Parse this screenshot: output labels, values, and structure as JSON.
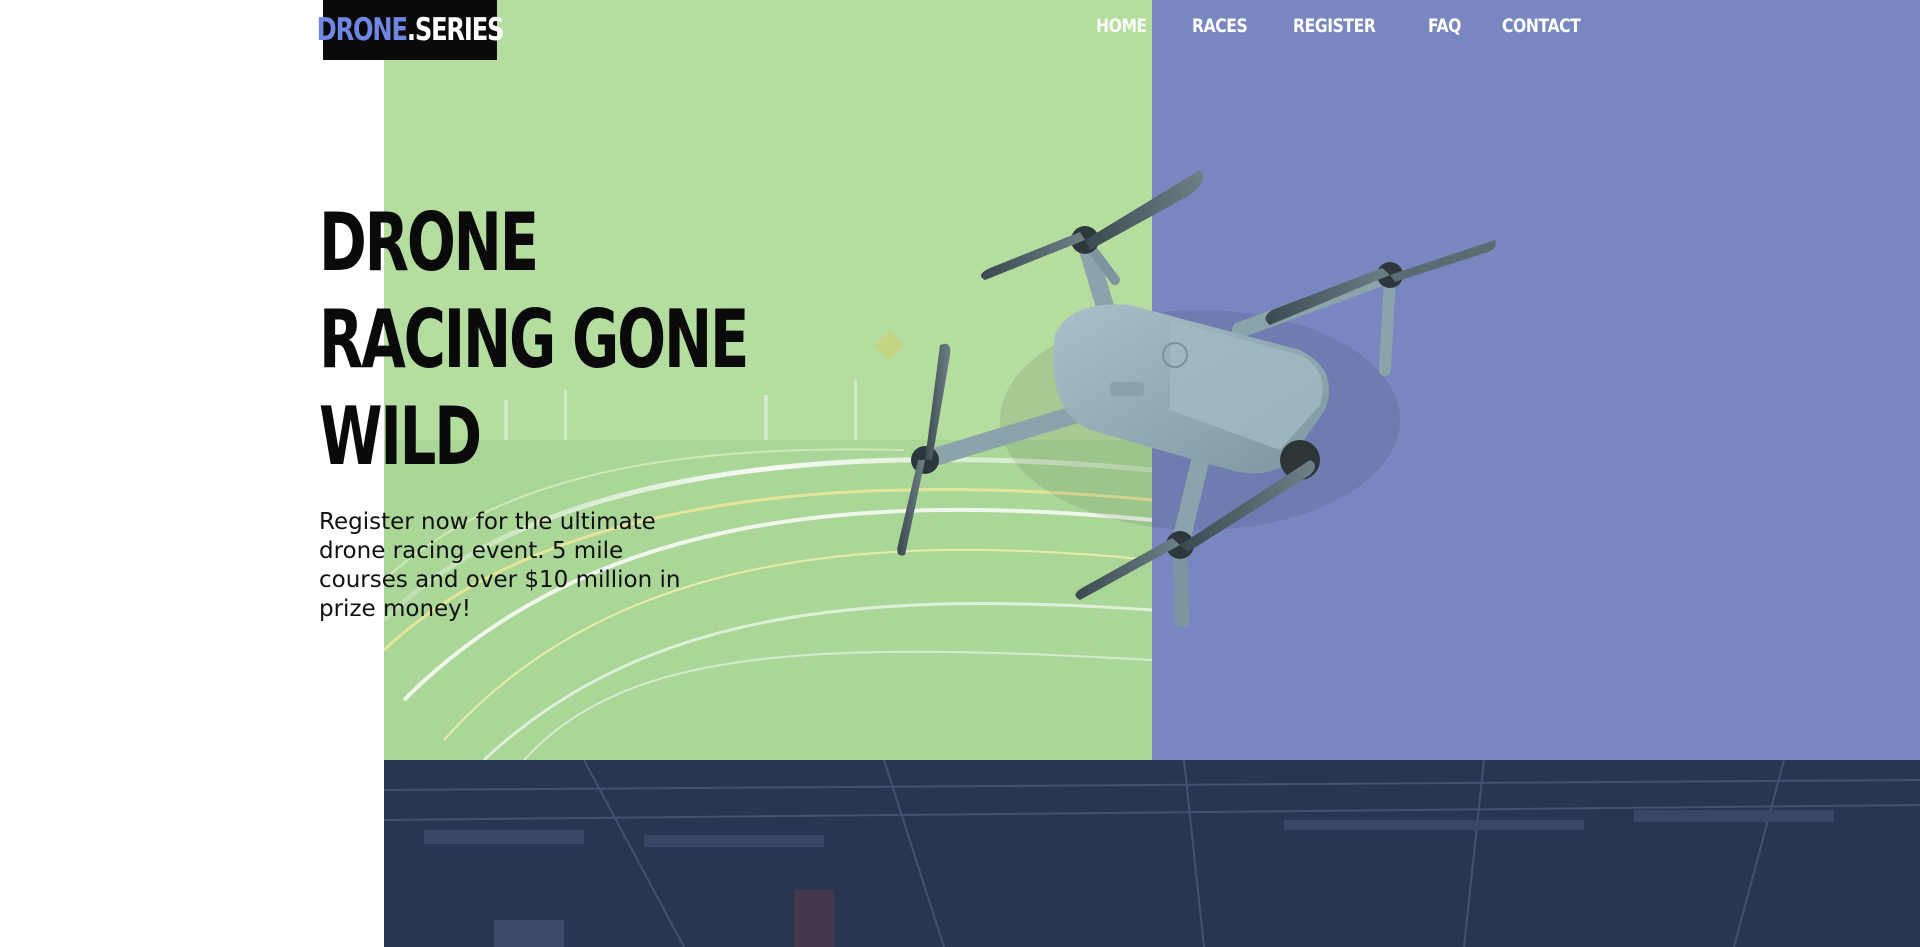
{
  "brand": {
    "name_part_a": "DRONE",
    "name_part_b": ".SERIES"
  },
  "nav": {
    "items": [
      {
        "label": "HOME"
      },
      {
        "label": "RACES"
      },
      {
        "label": "REGISTER"
      },
      {
        "label": "FAQ"
      },
      {
        "label": "CONTACT"
      }
    ]
  },
  "hero": {
    "title_lines": [
      "DRONE",
      "RACING GONE",
      "WILD"
    ],
    "description": "Register now for the ultimate drone racing event. 5 mile courses and over $10 million in prize money!"
  },
  "colors": {
    "accent_blue": "#6f86e3",
    "panel_green": "#b4dd9f",
    "panel_blue": "#7887c0",
    "logo_bg": "#0a0a0a",
    "stadium_bg": "#2a3552"
  },
  "icons": {
    "hero_image": "drone-image",
    "light_trails": "light-trails-image",
    "stadium": "stadium-image"
  }
}
